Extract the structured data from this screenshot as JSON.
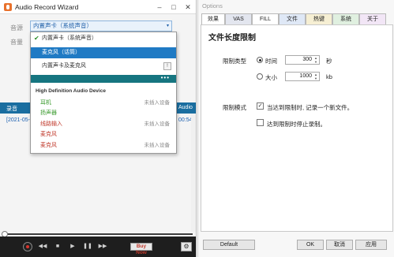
{
  "left_window": {
    "title": "Audio Record Wizard",
    "window_controls": {
      "minimize": "–",
      "maximize": "□",
      "close": "✕"
    },
    "source_label": "音源",
    "volume_label": "音量",
    "source_select": {
      "value": "内置声卡（系统声音）",
      "arrow": "▾"
    },
    "dropdown": {
      "items": [
        {
          "label": "内置声卡（系统声音）",
          "check": "✔"
        },
        {
          "label": "麦克风（话筒）"
        },
        {
          "label": "内置声卡及麦克风",
          "badge": "!"
        }
      ],
      "bar_dots": "•••",
      "device_header": "High Definition Audio Device",
      "devices": [
        {
          "name": "耳机",
          "status": "未插入设备",
          "color": "#3b9b2f"
        },
        {
          "name": "扬声器",
          "status": "",
          "color": "#3b9b2f"
        },
        {
          "name": "线路输入",
          "status": "未插入设备",
          "color": "#c0392b"
        },
        {
          "name": "麦克风",
          "status": "",
          "color": "#c0392b"
        },
        {
          "name": "麦克风",
          "status": "未插入设备",
          "color": "#c0392b"
        }
      ]
    },
    "list_header": {
      "left": "录音",
      "right": "Audio"
    },
    "list_row": {
      "date": "[2021-05-",
      "duration": "00:54"
    },
    "controls": {
      "prev": "◀◀",
      "stop": "■",
      "play": "▶",
      "pause": "❚❚",
      "next": "▶▶",
      "buy_label": "Buy Now",
      "gear": "⚙"
    }
  },
  "options_window": {
    "title": "Options",
    "tabs": [
      {
        "label": "效果",
        "color": "#ffffff"
      },
      {
        "label": "VAS",
        "color": "#e3e6ef"
      },
      {
        "label": "FILL",
        "color": "#ffffff",
        "active": true
      },
      {
        "label": "文件",
        "color": "#dfe8f6"
      },
      {
        "label": "热键",
        "color": "#f6efd3"
      },
      {
        "label": "系统",
        "color": "#e0f0e0"
      },
      {
        "label": "关于",
        "color": "#f2e6f6"
      }
    ],
    "panel_title": "文件长度限制",
    "limit_type_label": "限制类型",
    "time_option": {
      "label": "时间",
      "value": "300",
      "unit": "秒",
      "selected": true
    },
    "size_option": {
      "label": "大小",
      "value": "1000",
      "unit": "kb",
      "selected": false
    },
    "limit_mode_label": "限制模式",
    "checkbox_new_file": {
      "label": "当达到限制时, 记录一个新文件。",
      "checked": true
    },
    "checkbox_stop": {
      "label": "达到限制时停止录制。",
      "checked": false
    },
    "spin_arrows": {
      "up": "▲",
      "down": "▼"
    },
    "footer": {
      "default_label": "Default",
      "ok_label": "OK",
      "cancel_label": "取消",
      "apply_label": "应用"
    }
  }
}
